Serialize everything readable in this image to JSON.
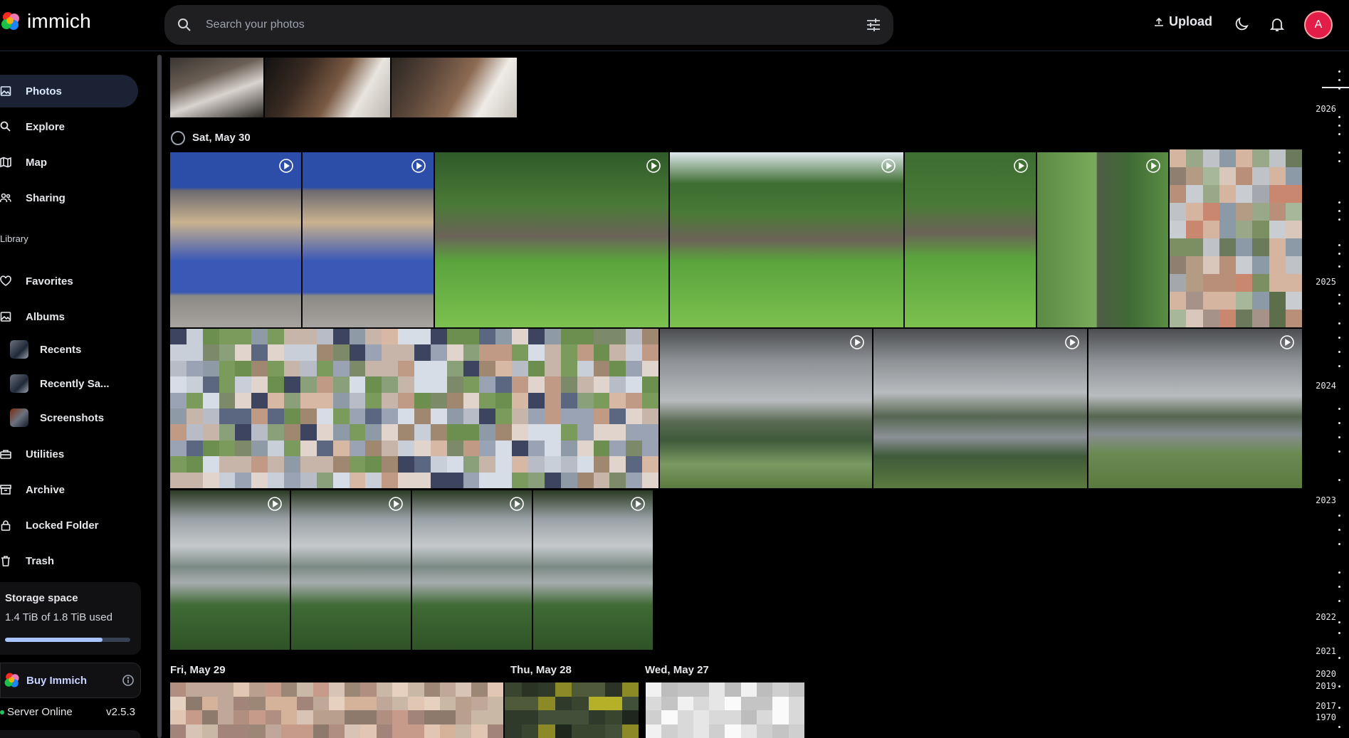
{
  "app": {
    "name": "immich",
    "accent": "#4250af"
  },
  "header": {
    "search_placeholder": "Search your photos",
    "upload_label": "Upload",
    "avatar_initial": "A"
  },
  "sidebar": {
    "nav": [
      {
        "label": "Photos",
        "icon": "photo-icon",
        "active": true
      },
      {
        "label": "Explore",
        "icon": "search-icon"
      },
      {
        "label": "Map",
        "icon": "map-icon"
      },
      {
        "label": "Sharing",
        "icon": "people-icon"
      }
    ],
    "library_label": "Library",
    "library": [
      {
        "label": "Favorites",
        "icon": "heart-icon"
      },
      {
        "label": "Albums",
        "icon": "album-icon"
      }
    ],
    "albums": [
      {
        "label": "Recents"
      },
      {
        "label": "Recently Sa..."
      },
      {
        "label": "Screenshots"
      }
    ],
    "more": [
      {
        "label": "Utilities",
        "icon": "utilities-icon"
      },
      {
        "label": "Archive",
        "icon": "archive-icon"
      },
      {
        "label": "Locked Folder",
        "icon": "lock-icon"
      },
      {
        "label": "Trash",
        "icon": "trash-icon"
      }
    ],
    "storage": {
      "title": "Storage space",
      "used_text": "1.4 TiB of 1.8 TiB used",
      "used_fraction": 0.78
    },
    "buy_label": "Buy Immich",
    "server_status": "Server Online",
    "server_version": "v2.5.3"
  },
  "timeline": {
    "groups": [
      {
        "date": "Sat, May 30"
      },
      {
        "date": "Fri, May 29"
      },
      {
        "date": "Thu, May 28"
      },
      {
        "date": "Wed, May 27"
      }
    ]
  },
  "scrubber": {
    "years": [
      "2026",
      "2025",
      "2024",
      "2023",
      "2022",
      "2021",
      "2020",
      "2019",
      "2017",
      "1970"
    ]
  }
}
